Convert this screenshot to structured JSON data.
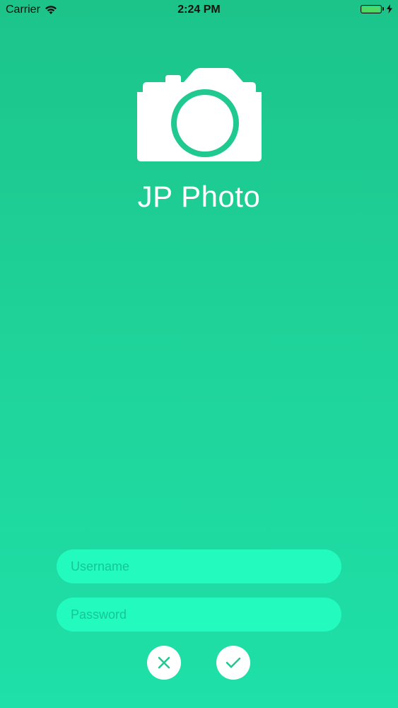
{
  "status_bar": {
    "carrier": "Carrier",
    "time": "2:24 PM",
    "icons": [
      "wifi-icon",
      "battery-icon",
      "charging-bolt-icon"
    ]
  },
  "app": {
    "title": "JP Photo",
    "logo_icon": "camera-icon"
  },
  "form": {
    "username_placeholder": "Username",
    "username_value": "",
    "password_placeholder": "Password",
    "password_value": "",
    "cancel_icon": "close-icon",
    "confirm_icon": "check-icon"
  },
  "colors": {
    "background_top": "#1cc48a",
    "background_bottom": "#1ee0a8",
    "input_fill": "#22fbbd",
    "icon_accent": "#1fc98f",
    "battery_fill": "#4cd964"
  }
}
